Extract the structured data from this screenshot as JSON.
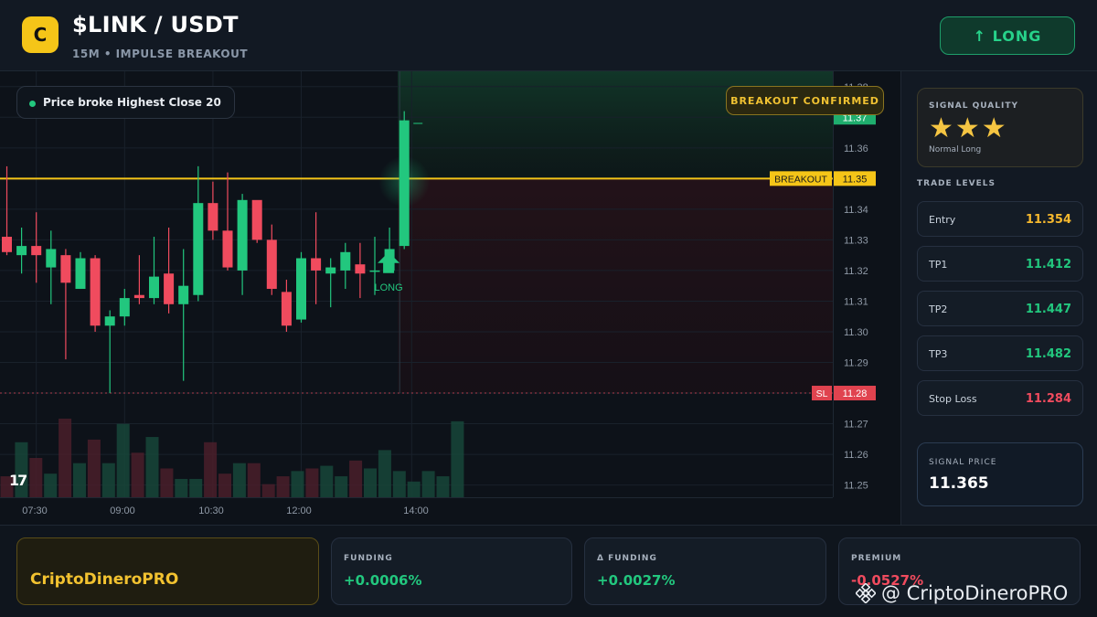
{
  "header": {
    "logo_letter": "C",
    "pair": "$LINK / USDT",
    "subtitle": "15M • IMPULSE BREAKOUT",
    "signal_button": "↑ LONG"
  },
  "chart": {
    "callout": "Price broke Highest Close 20",
    "badge": "BREAKOUT CONFIRMED",
    "tv_logo": "17",
    "long_label": "LONG",
    "lines": {
      "breakout": {
        "label": "BREAKOUT",
        "value": 11.35
      },
      "stop": {
        "label": "SL",
        "value": 11.28
      },
      "last": {
        "value": 11.37
      }
    }
  },
  "chart_data": {
    "type": "candlestick",
    "y_ticks": [
      "11.38",
      "11.37",
      "11.36",
      "11.35",
      "11.34",
      "11.33",
      "11.32",
      "11.31",
      "11.30",
      "11.29",
      "11.28",
      "11.27",
      "11.26",
      "11.25"
    ],
    "ylim": [
      11.246,
      11.385
    ],
    "x_ticks": [
      "07:30",
      "09:00",
      "10:30",
      "12:00",
      "14:00"
    ],
    "candles": [
      {
        "o": 11.331,
        "h": 11.354,
        "l": 11.325,
        "c": 11.326
      },
      {
        "o": 11.325,
        "h": 11.334,
        "l": 11.319,
        "c": 11.328
      },
      {
        "o": 11.328,
        "h": 11.339,
        "l": 11.316,
        "c": 11.325
      },
      {
        "o": 11.321,
        "h": 11.333,
        "l": 11.309,
        "c": 11.327
      },
      {
        "o": 11.325,
        "h": 11.327,
        "l": 11.291,
        "c": 11.316
      },
      {
        "o": 11.314,
        "h": 11.326,
        "l": 11.314,
        "c": 11.324
      },
      {
        "o": 11.324,
        "h": 11.325,
        "l": 11.3,
        "c": 11.302
      },
      {
        "o": 11.302,
        "h": 11.307,
        "l": 11.28,
        "c": 11.305
      },
      {
        "o": 11.305,
        "h": 11.314,
        "l": 11.302,
        "c": 11.311
      },
      {
        "o": 11.312,
        "h": 11.325,
        "l": 11.309,
        "c": 11.311
      },
      {
        "o": 11.311,
        "h": 11.331,
        "l": 11.309,
        "c": 11.318
      },
      {
        "o": 11.319,
        "h": 11.334,
        "l": 11.306,
        "c": 11.309
      },
      {
        "o": 11.309,
        "h": 11.327,
        "l": 11.284,
        "c": 11.315
      },
      {
        "o": 11.312,
        "h": 11.354,
        "l": 11.31,
        "c": 11.342
      },
      {
        "o": 11.342,
        "h": 11.349,
        "l": 11.33,
        "c": 11.333
      },
      {
        "o": 11.333,
        "h": 11.352,
        "l": 11.32,
        "c": 11.321
      },
      {
        "o": 11.32,
        "h": 11.345,
        "l": 11.312,
        "c": 11.343
      },
      {
        "o": 11.343,
        "h": 11.342,
        "l": 11.329,
        "c": 11.33
      },
      {
        "o": 11.33,
        "h": 11.335,
        "l": 11.312,
        "c": 11.314
      },
      {
        "o": 11.313,
        "h": 11.317,
        "l": 11.3,
        "c": 11.302
      },
      {
        "o": 11.304,
        "h": 11.326,
        "l": 11.303,
        "c": 11.324
      },
      {
        "o": 11.324,
        "h": 11.339,
        "l": 11.309,
        "c": 11.32
      },
      {
        "o": 11.319,
        "h": 11.324,
        "l": 11.308,
        "c": 11.321
      },
      {
        "o": 11.32,
        "h": 11.329,
        "l": 11.314,
        "c": 11.326
      },
      {
        "o": 11.322,
        "h": 11.329,
        "l": 11.311,
        "c": 11.319
      },
      {
        "o": 11.32,
        "h": 11.331,
        "l": 11.312,
        "c": 11.32
      },
      {
        "o": 11.32,
        "h": 11.334,
        "l": 11.32,
        "c": 11.327
      },
      {
        "o": 11.328,
        "h": 11.372,
        "l": 11.327,
        "c": 11.369
      }
    ],
    "volumes": [
      8,
      21,
      15,
      9,
      30,
      13,
      22,
      13,
      28,
      17,
      23,
      11,
      7,
      7,
      21,
      9,
      13,
      13,
      5,
      8,
      10,
      11,
      12,
      8,
      14,
      11,
      18,
      10,
      6,
      10,
      8,
      29
    ]
  },
  "sidebar": {
    "quality_label": "SIGNAL QUALITY",
    "stars": "★★★",
    "rating": 3,
    "quality_text": "Normal Long",
    "levels_title": "TRADE LEVELS",
    "levels": [
      {
        "name": "Entry",
        "value": "11.354",
        "color": "#f5b82e"
      },
      {
        "name": "TP1",
        "value": "11.412",
        "color": "#22c77e"
      },
      {
        "name": "TP2",
        "value": "11.447",
        "color": "#22c77e"
      },
      {
        "name": "TP3",
        "value": "11.482",
        "color": "#22c77e"
      },
      {
        "name": "Stop Loss",
        "value": "11.284",
        "color": "#f04b5e"
      }
    ],
    "signal_price_label": "SIGNAL PRICE",
    "signal_price": "11.365"
  },
  "footer": {
    "brand": "CriptoDineroPRO",
    "stats": [
      {
        "label": "FUNDING",
        "value": "+0.0006%",
        "color": "#22c77e"
      },
      {
        "label": "Δ FUNDING",
        "value": "+0.0027%",
        "color": "#22c77e"
      },
      {
        "label": "PREMIUM",
        "value": "-0.0527%",
        "color": "#f04b5e"
      }
    ],
    "watermark": "@ CriptoDineroPRO"
  },
  "colors": {
    "up": "#22c77e",
    "down": "#f04b5e",
    "accent": "#f5c518"
  }
}
